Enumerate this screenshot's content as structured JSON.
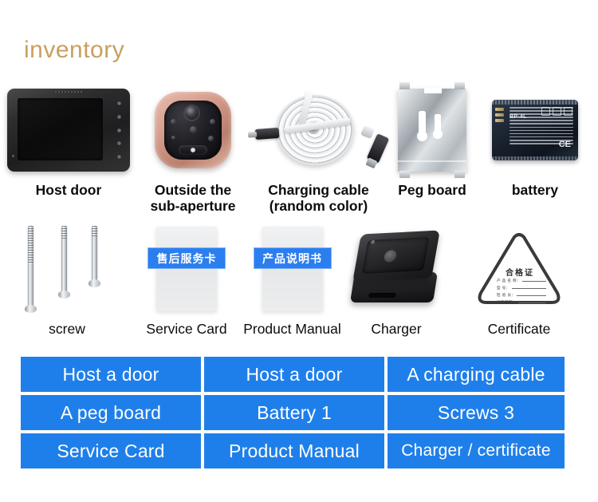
{
  "title": "inventory",
  "theme": {
    "title_color": "#c8a05e",
    "table_blue": "#1f7fea",
    "table_text": "#ffffff",
    "background": "#ffffff"
  },
  "products": {
    "row1": [
      {
        "icon": "host-door-monitor",
        "label": "Host door"
      },
      {
        "icon": "outside-sub-aperture-camera",
        "label": "Outside the\nsub-aperture"
      },
      {
        "icon": "charging-cable",
        "label": "Charging cable\n(random color)"
      },
      {
        "icon": "peg-board",
        "label": "Peg board"
      },
      {
        "icon": "battery",
        "label": "battery"
      }
    ],
    "row2": [
      {
        "icon": "screws",
        "label": "screw"
      },
      {
        "icon": "service-card",
        "label": "Service Card",
        "card_text": "售后服务卡"
      },
      {
        "icon": "product-manual",
        "label": "Product Manual",
        "card_text": "产品说明书"
      },
      {
        "icon": "charger-dock",
        "label": "Charger"
      },
      {
        "icon": "certificate-triangle",
        "label": "Certificate"
      }
    ]
  },
  "certificate": {
    "heading": "合格证",
    "fields": [
      "产 品 名 称：",
      "型 号：",
      "检 验 员：",
      "出厂日期："
    ]
  },
  "battery_print": {
    "brand": "BP-4L",
    "ce_mark": "CE"
  },
  "summary_table": {
    "rows": [
      [
        "Host a door",
        "Host a door",
        "A charging cable"
      ],
      [
        "A peg board",
        "Battery 1",
        "Screws 3"
      ],
      [
        "Service Card",
        "Product Manual",
        "Charger / certificate"
      ]
    ]
  }
}
